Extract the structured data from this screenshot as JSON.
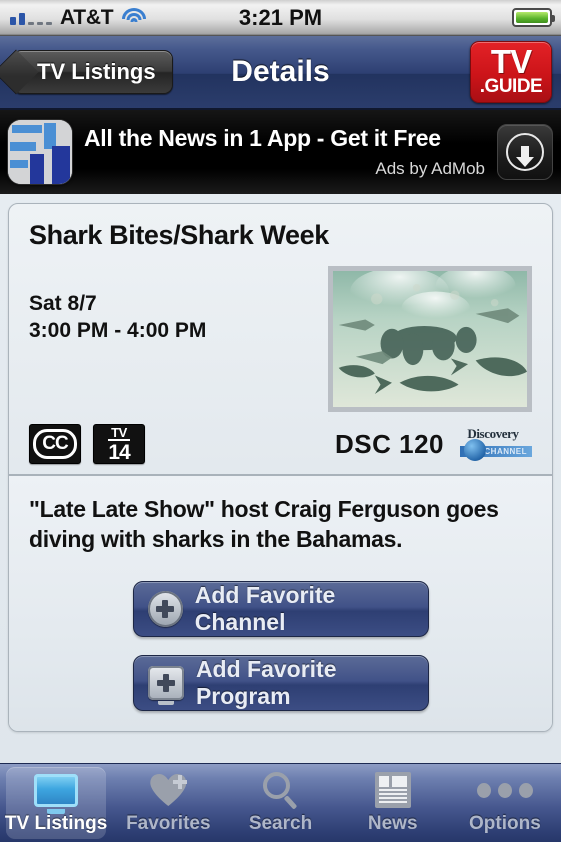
{
  "statusbar": {
    "carrier": "AT&T",
    "time": "3:21 PM",
    "signal_icon": "signal-bars-icon",
    "wifi_icon": "wifi-icon",
    "battery_icon": "battery-icon"
  },
  "navbar": {
    "back_label": "TV Listings",
    "title": "Details",
    "logo_line1": "TV",
    "logo_line2": ".GUIDE",
    "logo_color": "#cc1419"
  },
  "ad": {
    "title": "All the News in 1 App - Get it Free",
    "attribution": "Ads by AdMob",
    "icon_name": "news-app-icon",
    "download_icon": "download-arrow-icon"
  },
  "program": {
    "title": "Shark Bites/Shark Week",
    "date": "Sat 8/7",
    "time_range": "3:00 PM - 4:00 PM",
    "thumbnail_name": "shark-dive-photo",
    "cc_label": "CC",
    "rating_prefix": "TV",
    "rating_value": "14",
    "channel": "DSC 120",
    "channel_logo_word": "Discovery",
    "channel_logo_sub": "CHANNEL",
    "description": "\"Late Late Show\" host Craig Ferguson goes diving with sharks in the Bahamas."
  },
  "actions": [
    {
      "label": "Add Favorite Channel",
      "icon": "plus-circle-icon"
    },
    {
      "label": "Add Favorite Program",
      "icon": "plus-tv-icon"
    }
  ],
  "tabbar": {
    "items": [
      {
        "label": "TV Listings",
        "icon": "tv-icon",
        "active": true
      },
      {
        "label": "Favorites",
        "icon": "heart-plus-icon",
        "active": false
      },
      {
        "label": "Search",
        "icon": "magnifier-icon",
        "active": false
      },
      {
        "label": "News",
        "icon": "newspaper-icon",
        "active": false
      },
      {
        "label": "Options",
        "icon": "ellipsis-icon",
        "active": false
      }
    ]
  }
}
